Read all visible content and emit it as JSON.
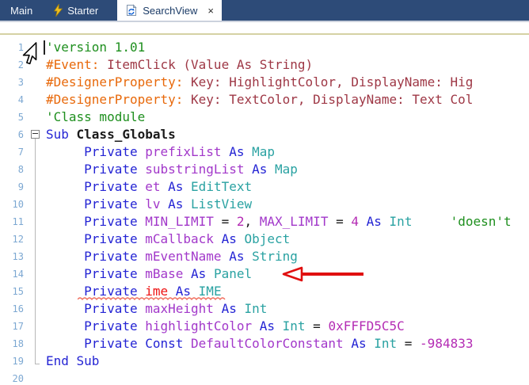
{
  "tab_bar": {
    "tabs": [
      {
        "label": "Main"
      },
      {
        "label": "Starter"
      },
      {
        "label": "SearchView"
      }
    ],
    "close_glyph": "×"
  },
  "colors": {
    "tabbar_bg": "#2d4b78",
    "active_tab_text": "#1a3a66",
    "keyword": "#2424d4",
    "variable": "#a238ca",
    "type": "#2aa2a2",
    "comment": "#1e8f1e",
    "preprocessor": "#e8690b",
    "directive_text": "#9e3745",
    "number": "#b42cb4",
    "error_text": "#ee1111",
    "line_number": "#7da8d2",
    "annotation_arrow": "#e01010",
    "error_squiggle": "#f07060",
    "separator_khaki": "#d5d1a4"
  },
  "editor": {
    "lines": [
      {
        "n": "1",
        "fold": "",
        "caret": true,
        "seg": [
          {
            "t": "'version 1.01",
            "c": "comment"
          }
        ]
      },
      {
        "n": "2",
        "fold": "",
        "seg": [
          {
            "t": "#Event:",
            "c": "pre"
          },
          {
            "t": " ItemClick (Value As String)",
            "c": "dir"
          }
        ]
      },
      {
        "n": "3",
        "fold": "",
        "seg": [
          {
            "t": "#DesignerProperty:",
            "c": "pre"
          },
          {
            "t": " Key: HighlightColor, DisplayName: Hig",
            "c": "dir"
          }
        ]
      },
      {
        "n": "4",
        "fold": "",
        "seg": [
          {
            "t": "#DesignerProperty:",
            "c": "pre"
          },
          {
            "t": " Key: TextColor, DisplayName: Text Col",
            "c": "dir"
          }
        ]
      },
      {
        "n": "5",
        "fold": "",
        "seg": [
          {
            "t": "'Class module",
            "c": "comment"
          }
        ]
      },
      {
        "n": "6",
        "fold": "start",
        "seg": [
          {
            "t": "Sub ",
            "c": "kw"
          },
          {
            "t": "Class_Globals",
            "c": "decl"
          }
        ]
      },
      {
        "n": "7",
        "fold": "mid",
        "seg": [
          {
            "t": "     Private ",
            "c": "kw"
          },
          {
            "t": "prefixList ",
            "c": "var"
          },
          {
            "t": "As ",
            "c": "kw"
          },
          {
            "t": "Map",
            "c": "type"
          }
        ]
      },
      {
        "n": "8",
        "fold": "mid",
        "seg": [
          {
            "t": "     Private ",
            "c": "kw"
          },
          {
            "t": "substringList ",
            "c": "var"
          },
          {
            "t": "As ",
            "c": "kw"
          },
          {
            "t": "Map",
            "c": "type"
          }
        ]
      },
      {
        "n": "9",
        "fold": "mid",
        "seg": [
          {
            "t": "     Private ",
            "c": "kw"
          },
          {
            "t": "et ",
            "c": "var"
          },
          {
            "t": "As ",
            "c": "kw"
          },
          {
            "t": "EditText",
            "c": "type"
          }
        ]
      },
      {
        "n": "10",
        "fold": "mid",
        "seg": [
          {
            "t": "     Private ",
            "c": "kw"
          },
          {
            "t": "lv ",
            "c": "var"
          },
          {
            "t": "As ",
            "c": "kw"
          },
          {
            "t": "ListView",
            "c": "type"
          }
        ]
      },
      {
        "n": "11",
        "fold": "mid",
        "seg": [
          {
            "t": "     Private ",
            "c": "kw"
          },
          {
            "t": "MIN_LIMIT",
            "c": "var"
          },
          {
            "t": " = ",
            "c": "plain"
          },
          {
            "t": "2",
            "c": "num"
          },
          {
            "t": ", ",
            "c": "plain"
          },
          {
            "t": "MAX_LIMIT",
            "c": "var"
          },
          {
            "t": " = ",
            "c": "plain"
          },
          {
            "t": "4",
            "c": "num"
          },
          {
            "t": " ",
            "c": "plain"
          },
          {
            "t": "As ",
            "c": "kw"
          },
          {
            "t": "Int",
            "c": "type"
          },
          {
            "t": "     ",
            "c": "plain"
          },
          {
            "t": "'doesn't",
            "c": "comment"
          }
        ]
      },
      {
        "n": "12",
        "fold": "mid",
        "seg": [
          {
            "t": "     Private ",
            "c": "kw"
          },
          {
            "t": "mCallback ",
            "c": "var"
          },
          {
            "t": "As ",
            "c": "kw"
          },
          {
            "t": "Object",
            "c": "type"
          }
        ]
      },
      {
        "n": "13",
        "fold": "mid",
        "seg": [
          {
            "t": "     Private ",
            "c": "kw"
          },
          {
            "t": "mEventName ",
            "c": "var"
          },
          {
            "t": "As ",
            "c": "kw"
          },
          {
            "t": "String",
            "c": "type"
          }
        ]
      },
      {
        "n": "14",
        "fold": "mid",
        "arrow": true,
        "seg": [
          {
            "t": "     Private ",
            "c": "kw"
          },
          {
            "t": "mBase ",
            "c": "var"
          },
          {
            "t": "As ",
            "c": "kw"
          },
          {
            "t": "Panel",
            "c": "type"
          }
        ]
      },
      {
        "n": "15",
        "fold": "mid",
        "squiggle": true,
        "seg": [
          {
            "t": "     Private ",
            "c": "kw"
          },
          {
            "t": "ime ",
            "c": "err"
          },
          {
            "t": "As ",
            "c": "kw"
          },
          {
            "t": "IME",
            "c": "type"
          }
        ]
      },
      {
        "n": "16",
        "fold": "mid",
        "seg": [
          {
            "t": "     Private ",
            "c": "kw"
          },
          {
            "t": "maxHeight ",
            "c": "var"
          },
          {
            "t": "As ",
            "c": "kw"
          },
          {
            "t": "Int",
            "c": "type"
          }
        ]
      },
      {
        "n": "17",
        "fold": "mid",
        "seg": [
          {
            "t": "     Private ",
            "c": "kw"
          },
          {
            "t": "highlightColor ",
            "c": "var"
          },
          {
            "t": "As ",
            "c": "kw"
          },
          {
            "t": "Int",
            "c": "type"
          },
          {
            "t": " = ",
            "c": "plain"
          },
          {
            "t": "0xFFFD5C5C",
            "c": "num"
          }
        ]
      },
      {
        "n": "18",
        "fold": "mid",
        "seg": [
          {
            "t": "     Private Const ",
            "c": "kw"
          },
          {
            "t": "DefaultColorConstant ",
            "c": "var"
          },
          {
            "t": "As ",
            "c": "kw"
          },
          {
            "t": "Int",
            "c": "type"
          },
          {
            "t": " = ",
            "c": "plain"
          },
          {
            "t": "-984833",
            "c": "num"
          }
        ]
      },
      {
        "n": "19",
        "fold": "end",
        "seg": [
          {
            "t": "End Sub",
            "c": "kw"
          }
        ]
      },
      {
        "n": "20",
        "fold": "",
        "seg": []
      }
    ]
  }
}
